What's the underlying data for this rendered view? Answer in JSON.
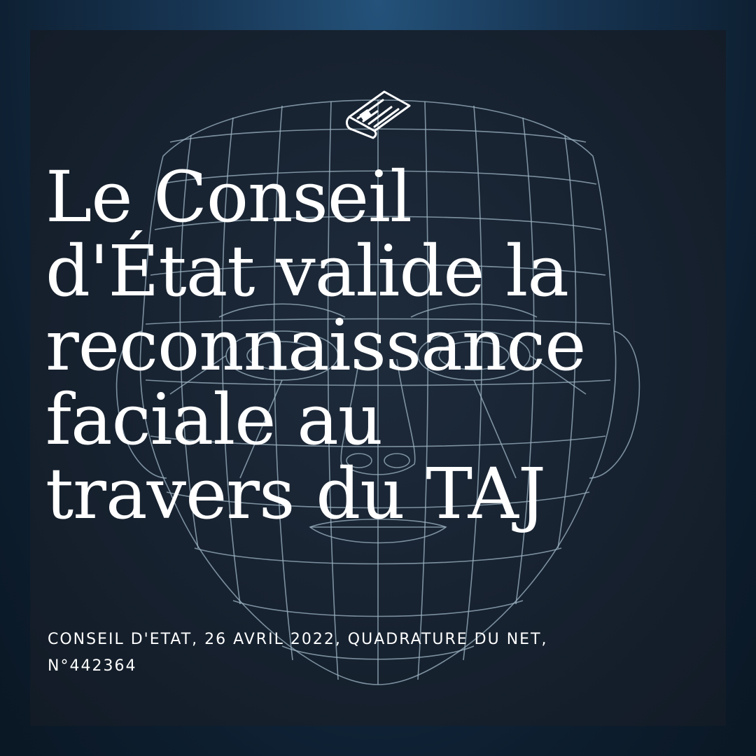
{
  "icon": "newspaper-icon",
  "colors": {
    "background_edge": "#173553",
    "card_background": "#172230",
    "mesh": "#9fb6c4",
    "text": "#ffffff"
  },
  "title": {
    "line1": "Le Conseil",
    "line2": "d'État valide la",
    "line3": "reconnaissance",
    "line4": "faciale au",
    "line5": "travers du TAJ"
  },
  "source": {
    "line1": "CONSEIL D'ETAT, 26 AVRIL 2022, QUADRATURE DU NET,",
    "line2": "N°442364"
  }
}
